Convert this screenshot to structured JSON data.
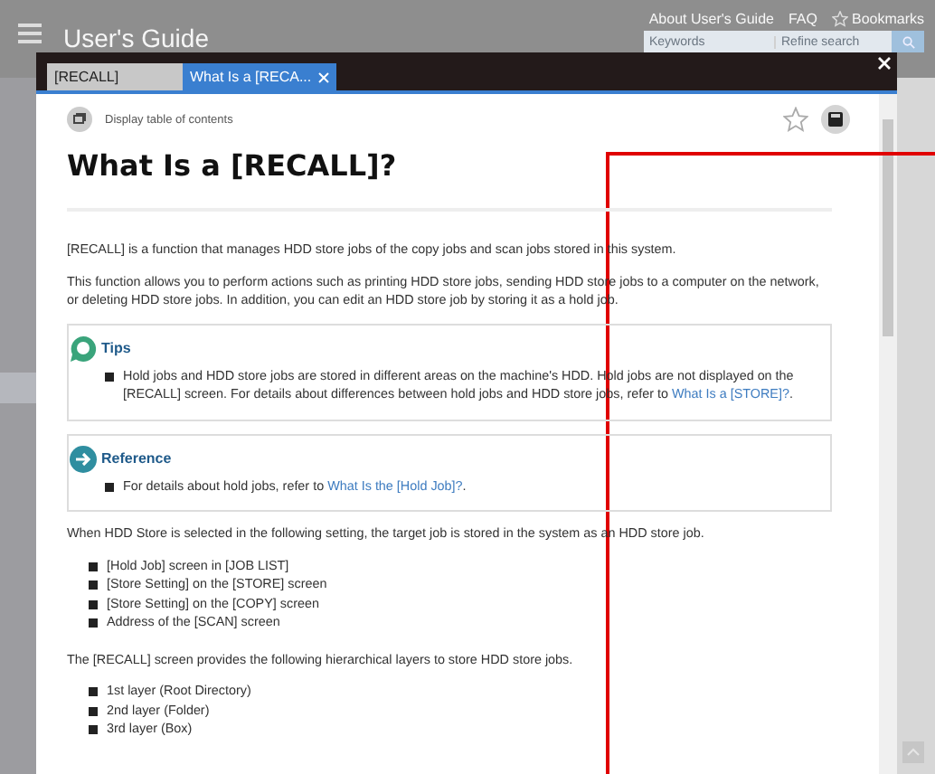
{
  "header": {
    "title": "User's Guide",
    "links": [
      "About User's Guide",
      "FAQ",
      "Bookmarks"
    ],
    "search": {
      "placeholder": "Keywords",
      "refine_placeholder": "Refine search"
    }
  },
  "dialog": {
    "tabs": [
      {
        "label": "[RECALL]",
        "selected": false
      },
      {
        "label": "What Is a [RECA...",
        "selected": true
      }
    ],
    "toc_label": "Display table of contents",
    "title": "What Is a [RECALL]?",
    "intro": [
      "[RECALL] is a function that manages HDD store jobs of the copy jobs and scan jobs stored in this system.",
      "This function allows you to perform actions such as printing HDD store jobs, sending HDD store jobs to a computer on the network, or deleting HDD store jobs. In addition, you can edit an HDD store job by storing it as a hold job."
    ],
    "notes": [
      {
        "kind": "tips",
        "heading": "Tips",
        "items": [
          {
            "text": "Hold jobs and HDD store jobs are stored in different areas on the machine's HDD. Hold jobs are not displayed on the [RECALL] screen. For details about differences between hold jobs and HDD store jobs, refer to ",
            "link": "What Is a [STORE]?",
            "after": "."
          }
        ]
      },
      {
        "kind": "reference",
        "heading": "Reference",
        "items": [
          {
            "text": "For details about hold jobs, refer to ",
            "link": "What Is the [Hold Job]?",
            "after": "."
          }
        ]
      }
    ],
    "sections": [
      {
        "text": "When HDD Store is selected in the following setting, the target job is stored in the system as an HDD store job.",
        "items": [
          "[Hold Job] screen in [JOB LIST]",
          "[Store Setting] on the [STORE] screen",
          "[Store Setting] on the [COPY] screen",
          "Address of the [SCAN] screen"
        ]
      },
      {
        "text": "The [RECALL] screen provides the following hierarchical layers to store HDD store jobs.",
        "items": [
          "1st layer (Root Directory)",
          "2nd layer (Folder)",
          "3rd layer (Box)"
        ]
      }
    ]
  }
}
